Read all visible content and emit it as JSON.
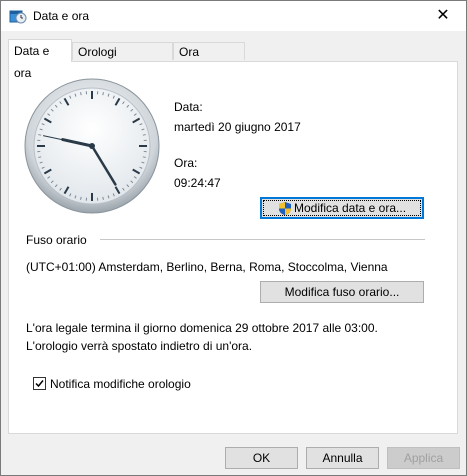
{
  "window": {
    "title": "Data e ora",
    "close_glyph": "✕"
  },
  "tabs": [
    {
      "label": "Data e ora",
      "active": true
    },
    {
      "label": "Orologi aggiuntivi",
      "active": false
    },
    {
      "label": "Ora Internet",
      "active": false
    }
  ],
  "date_section": {
    "date_label": "Data:",
    "date_value": "martedì 20 giugno 2017",
    "time_label": "Ora:",
    "time_value": "09:24:47",
    "change_button": "Modifica data e ora..."
  },
  "timezone": {
    "group_label": "Fuso orario",
    "value": "(UTC+01:00) Amsterdam, Berlino, Berna, Roma, Stoccolma, Vienna",
    "change_button": "Modifica fuso orario..."
  },
  "dst_notice": {
    "line1": "L'ora legale termina il giorno domenica 29 ottobre 2017 alle 03:00.",
    "line2": "L'orologio verrà spostato indietro di un'ora."
  },
  "notify_checkbox": {
    "label": "Notifica modifiche orologio",
    "checked": true
  },
  "footer": {
    "ok": "OK",
    "cancel": "Annulla",
    "apply": "Applica"
  },
  "clock": {
    "hours": 9,
    "minutes": 24,
    "seconds": 47
  },
  "icons": {
    "title": "clock-calendar-icon",
    "shield": "uac-shield-icon",
    "close": "close-icon",
    "check": "checkmark-icon"
  }
}
